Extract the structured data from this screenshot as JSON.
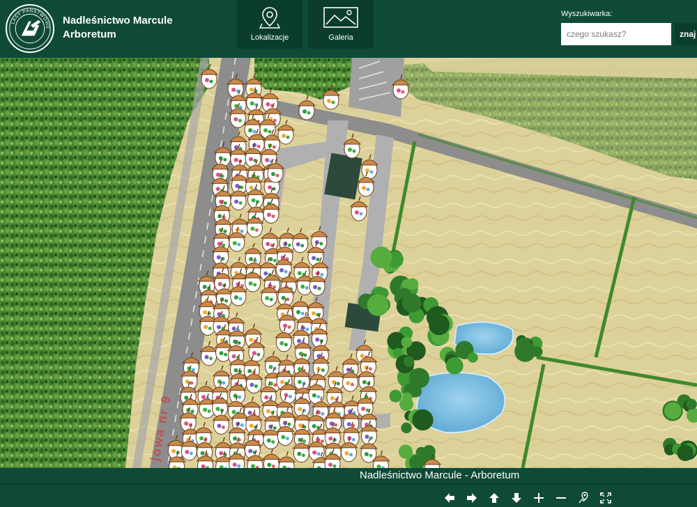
{
  "header": {
    "logo_text": "LASY PAŃSTWOWE",
    "title_line1": "Nadleśnictwo Marcule",
    "title_line2": "Arboretum",
    "nav": [
      {
        "label": "Lokalizacje",
        "icon": "map-pin-icon"
      },
      {
        "label": "Galeria",
        "icon": "image-gallery-icon"
      }
    ],
    "search": {
      "label": "Wyszukiwarka:",
      "placeholder": "czego szukasz?",
      "button": "znaj"
    }
  },
  "map": {
    "road_label": "jowa nr 9"
  },
  "footer": {
    "title": "Nadleśnictwo Marcule - Arboretum",
    "controls": [
      {
        "name": "pan-left-button",
        "icon": "arrow-left-icon"
      },
      {
        "name": "pan-right-button",
        "icon": "arrow-right-icon"
      },
      {
        "name": "pan-up-button",
        "icon": "arrow-up-icon"
      },
      {
        "name": "pan-down-button",
        "icon": "arrow-down-icon"
      },
      {
        "name": "zoom-in-button",
        "icon": "plus-icon"
      },
      {
        "name": "zoom-out-button",
        "icon": "minus-icon"
      },
      {
        "name": "locate-button",
        "icon": "location-icon"
      },
      {
        "name": "fullscreen-button",
        "icon": "fullscreen-icon"
      }
    ]
  },
  "colors": {
    "brand_dark": "#0f4a37",
    "brand_darker": "#0b3d2d",
    "field": "#dcd093",
    "forest": "#3f7a2c",
    "road": "#8d8d8d",
    "pond": "#7ec1e2",
    "marker_cap": "#c98a4a"
  }
}
